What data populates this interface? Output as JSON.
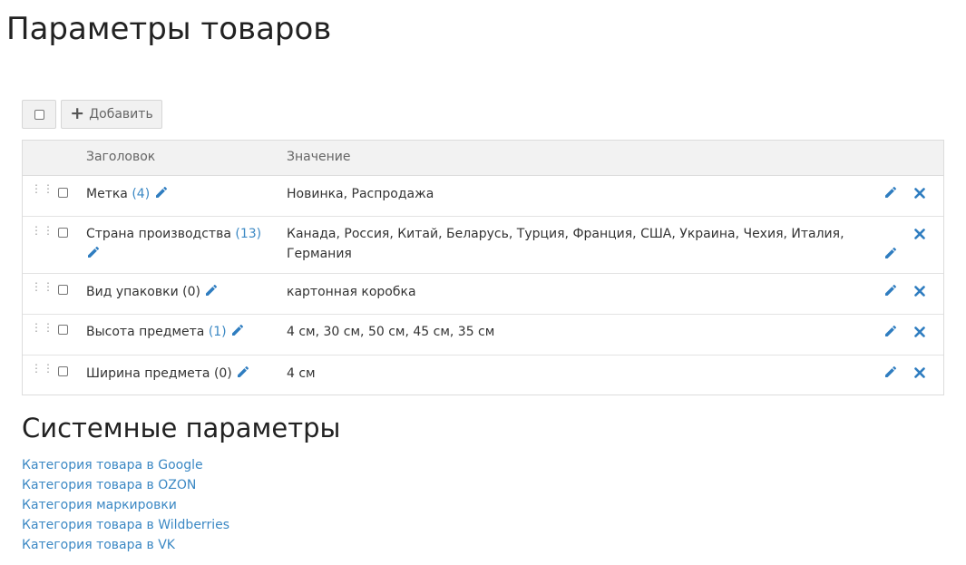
{
  "page": {
    "title": "Параметры товаров"
  },
  "toolbar": {
    "add_label": "Добавить"
  },
  "table": {
    "headers": {
      "title": "Заголовок",
      "value": "Значение"
    },
    "rows": [
      {
        "title": "Метка",
        "count": "(4)",
        "value": "Новинка, Распродажа"
      },
      {
        "title": "Страна производства",
        "count": "(13)",
        "value": "Канада, Россия, Китай, Беларусь, Турция, Франция, США, Украина, Чехия, Италия, Германия"
      },
      {
        "title": "Вид упаковки",
        "count": "(0)",
        "value": "картонная коробка"
      },
      {
        "title": "Высота предмета",
        "count": "(1)",
        "value": "4 см, 30 см, 50 см, 45 см, 35 см"
      },
      {
        "title": "Ширина предмета",
        "count": "(0)",
        "value": "4 см"
      }
    ]
  },
  "system": {
    "title": "Системные параметры",
    "links": [
      "Категория товара в Google",
      "Категория товара в OZON",
      "Категория маркировки",
      "Категория товара в Wildberries",
      "Категория товара в VK"
    ]
  },
  "colors": {
    "link": "#3b88c4",
    "count_linked": "#3b88c4",
    "count_zero": "#333333",
    "action_icon": "#2f7dc0",
    "header_bg": "#f2f2f2"
  },
  "icons": {
    "edit": "pencil-icon",
    "delete": "close-icon",
    "drag": "drag-handle-icon",
    "add": "plus-icon"
  }
}
